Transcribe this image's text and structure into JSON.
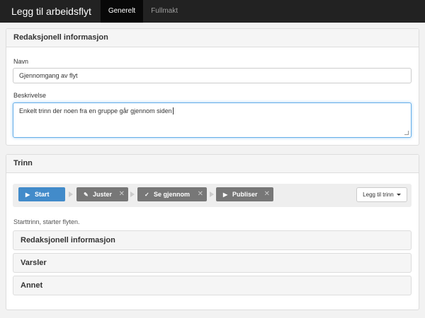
{
  "navbar": {
    "title": "Legg til arbeidsflyt",
    "tabs": [
      {
        "label": "Generelt",
        "active": true
      },
      {
        "label": "Fullmakt",
        "active": false
      }
    ]
  },
  "editorial_panel": {
    "heading": "Redaksjonell informasjon",
    "name_label": "Navn",
    "name_value": "Gjennomgang av flyt",
    "description_label": "Beskrivelse",
    "description_value": "Enkelt trinn der noen fra en gruppe går gjennom siden"
  },
  "steps_panel": {
    "heading": "Trinn",
    "steps": [
      {
        "label": "Start",
        "icon": "play-icon",
        "active": true,
        "removable": false
      },
      {
        "label": "Juster",
        "icon": "edit-icon",
        "active": false,
        "removable": true
      },
      {
        "label": "Se gjennom",
        "icon": "check-icon",
        "active": false,
        "removable": true
      },
      {
        "label": "Publiser",
        "icon": "play-icon",
        "active": false,
        "removable": true
      }
    ],
    "add_step_label": "Legg til trinn",
    "help_text": "Starttrinn, starter flyten.",
    "sections": [
      {
        "label": "Redaksjonell informasjon"
      },
      {
        "label": "Varsler"
      },
      {
        "label": "Annet"
      }
    ]
  },
  "colors": {
    "navbar_bg": "#222222",
    "active_step": "#428bca",
    "inactive_step": "#777777"
  }
}
